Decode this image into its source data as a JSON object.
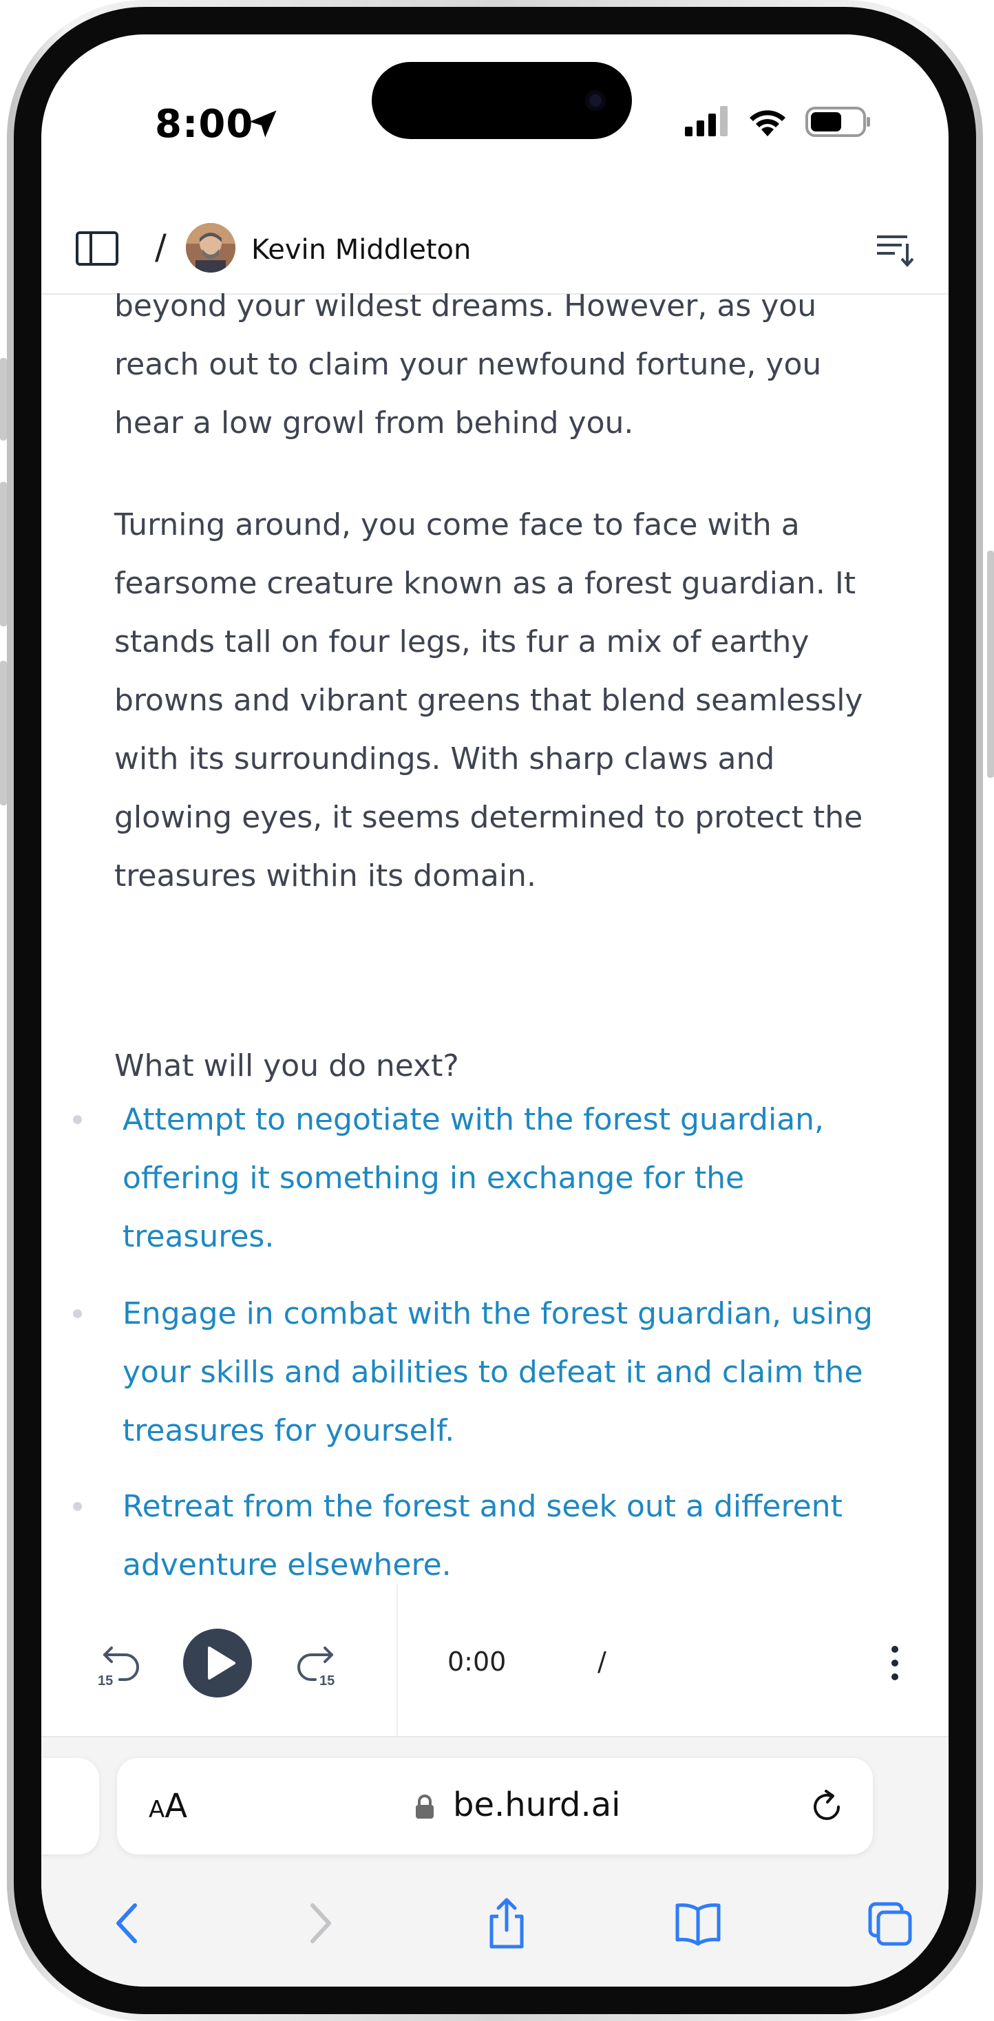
{
  "status": {
    "time": "8:00"
  },
  "header": {
    "separator": "/",
    "user_name": "Kevin Middleton"
  },
  "content": {
    "paragraphs": [
      "beyond your wildest dreams. However, as you reach out to claim your newfound fortune, you hear a low growl from behind you.",
      "Turning around, you come face to face with a fearsome creature known as a forest guardian. It stands tall on four legs, its fur a mix of earthy browns and vibrant greens that blend seamlessly with its surroundings. With sharp claws and glowing eyes, it seems determined to protect the treasures within its domain.",
      "What will you do next?"
    ],
    "options": [
      "Attempt to negotiate with the forest guardian, offering it something in exchange for the treasures.",
      "Engage in combat with the forest guardian, using your skills and abilities to defeat it and claim the treasures for yourself.",
      "Retreat from the forest and seek out a different adventure elsewhere."
    ]
  },
  "player": {
    "rewind_label": "15",
    "forward_label": "15",
    "current_time": "0:00",
    "separator": "/"
  },
  "browser": {
    "aa_small": "A",
    "aa_large": "A",
    "url": "be.hurd.ai"
  },
  "colors": {
    "link": "#1e88c2",
    "body_text": "#3f4451",
    "safari_blue": "#2f7cf6",
    "play_button": "#364152"
  }
}
